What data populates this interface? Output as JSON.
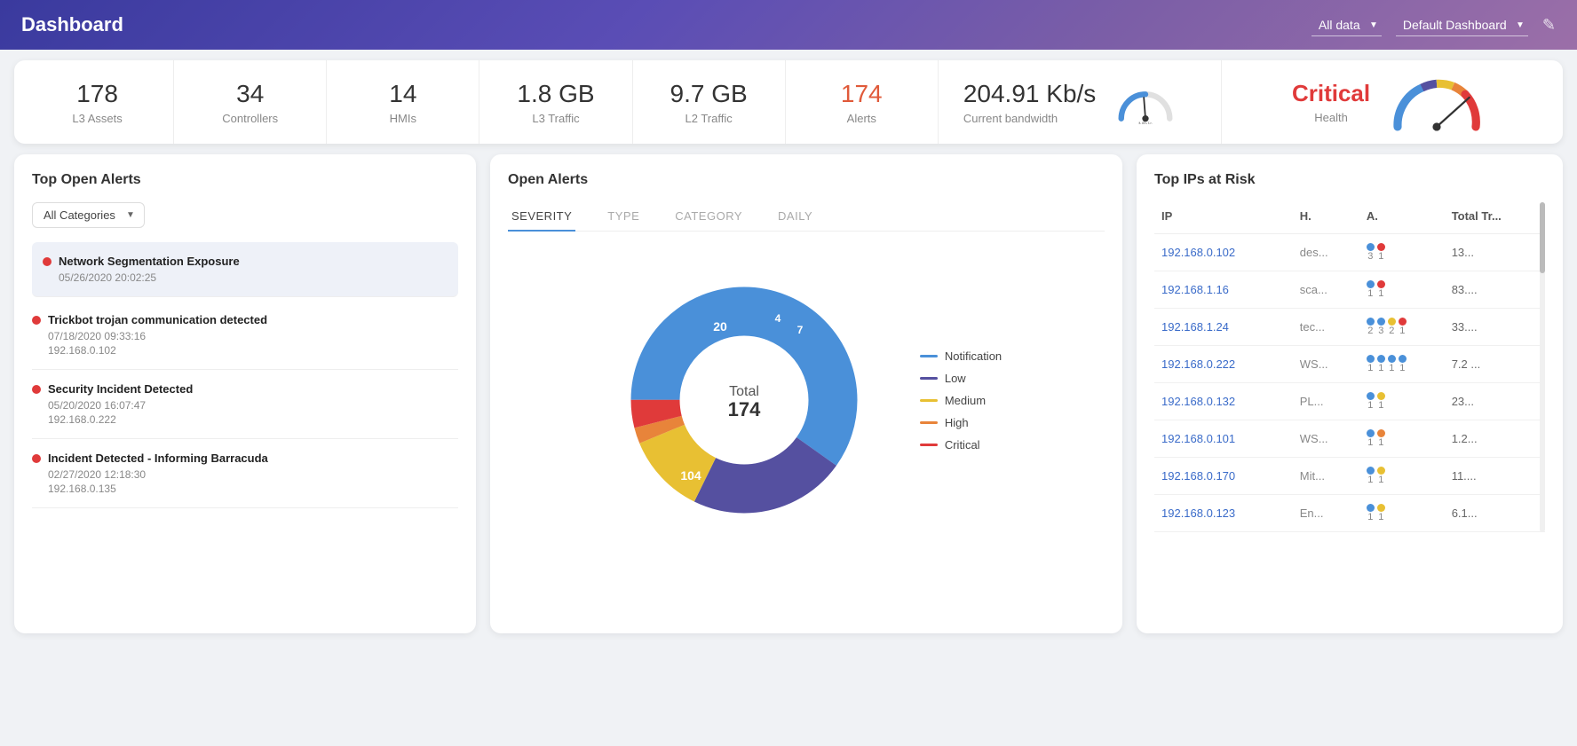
{
  "header": {
    "title": "Dashboard",
    "data_source": "All data",
    "dashboard_name": "Default Dashboard",
    "edit_icon": "✎"
  },
  "stats": [
    {
      "id": "l3-assets",
      "value": "178",
      "label": "L3 Assets",
      "color": "normal"
    },
    {
      "id": "controllers",
      "value": "34",
      "label": "Controllers",
      "color": "normal"
    },
    {
      "id": "hmis",
      "value": "14",
      "label": "HMIs",
      "color": "normal"
    },
    {
      "id": "l3-traffic",
      "value": "1.8 GB",
      "label": "L3 Traffic",
      "color": "normal"
    },
    {
      "id": "l2-traffic",
      "value": "9.7 GB",
      "label": "L2 Traffic",
      "color": "normal"
    },
    {
      "id": "alerts",
      "value": "174",
      "label": "Alerts",
      "color": "alert"
    },
    {
      "id": "bandwidth",
      "value": "204.91 Kb/s",
      "label": "Current bandwidth",
      "gauge": true
    },
    {
      "id": "health",
      "value": "Critical",
      "label": "Health",
      "color": "critical",
      "gauge": true
    }
  ],
  "top_open_alerts": {
    "title": "Top Open Alerts",
    "category_filter": "All Categories",
    "alerts": [
      {
        "title": "Network Segmentation Exposure",
        "timestamp": "05/26/2020 20:02:25",
        "ip": "",
        "selected": true
      },
      {
        "title": "Trickbot trojan communication detected",
        "timestamp": "07/18/2020 09:33:16",
        "ip": "192.168.0.102",
        "selected": false
      },
      {
        "title": "Security Incident Detected",
        "timestamp": "05/20/2020 16:07:47",
        "ip": "192.168.0.222",
        "selected": false
      },
      {
        "title": "Incident Detected - Informing Barracuda",
        "timestamp": "02/27/2020 12:18:30",
        "ip": "192.168.0.135",
        "selected": false
      }
    ]
  },
  "open_alerts_chart": {
    "title": "Open Alerts",
    "tabs": [
      "SEVERITY",
      "TYPE",
      "CATEGORY",
      "DAILY"
    ],
    "active_tab": "SEVERITY",
    "total": 174,
    "total_label": "Total 174",
    "segments": [
      {
        "label": "Notification",
        "value": 104,
        "color": "#4a90d9",
        "percent": 59.8
      },
      {
        "label": "Low",
        "value": 39,
        "color": "#5550a0",
        "percent": 22.4
      },
      {
        "label": "Medium",
        "value": 20,
        "color": "#e8c033",
        "percent": 11.5
      },
      {
        "label": "High",
        "value": 4,
        "color": "#e8843a",
        "percent": 2.3
      },
      {
        "label": "Critical",
        "value": 7,
        "color": "#e03a3a",
        "percent": 4.0
      }
    ]
  },
  "top_ips": {
    "title": "Top IPs at Risk",
    "columns": [
      "IP",
      "H.",
      "A.",
      "Total Tr..."
    ],
    "rows": [
      {
        "ip": "192.168.0.102",
        "category": "des...",
        "dots": [
          {
            "color": "#4a90d9",
            "n": "3"
          },
          {
            "color": "#e03a3a",
            "n": "1"
          }
        ],
        "total": "13..."
      },
      {
        "ip": "192.168.1.16",
        "category": "sca...",
        "dots": [
          {
            "color": "#4a90d9",
            "n": "1"
          },
          {
            "color": "#e03a3a",
            "n": "1"
          }
        ],
        "total": "83...."
      },
      {
        "ip": "192.168.1.24",
        "category": "tec...",
        "dots": [
          {
            "color": "#4a90d9",
            "n": "2"
          },
          {
            "color": "#4a90d9",
            "n": "3"
          },
          {
            "color": "#e8c033",
            "n": "2"
          },
          {
            "color": "#e03a3a",
            "n": "1"
          }
        ],
        "total": "33...."
      },
      {
        "ip": "192.168.0.222",
        "category": "WS...",
        "dots": [
          {
            "color": "#4a90d9",
            "n": "1"
          },
          {
            "color": "#4a90d9",
            "n": "1"
          },
          {
            "color": "#4a90d9",
            "n": "1"
          },
          {
            "color": "#4a90d9",
            "n": "1"
          }
        ],
        "total": "7.2 ..."
      },
      {
        "ip": "192.168.0.132",
        "category": "PL...",
        "dots": [
          {
            "color": "#4a90d9",
            "n": "1"
          },
          {
            "color": "#e8c033",
            "n": "1"
          }
        ],
        "total": "23..."
      },
      {
        "ip": "192.168.0.101",
        "category": "WS...",
        "dots": [
          {
            "color": "#4a90d9",
            "n": "1"
          },
          {
            "color": "#e8843a",
            "n": "1"
          }
        ],
        "total": "1.2..."
      },
      {
        "ip": "192.168.0.170",
        "category": "Mit...",
        "dots": [
          {
            "color": "#4a90d9",
            "n": "1"
          },
          {
            "color": "#e8c033",
            "n": "1"
          }
        ],
        "total": "11...."
      },
      {
        "ip": "192.168.0.123",
        "category": "En...",
        "dots": [
          {
            "color": "#4a90d9",
            "n": "1"
          },
          {
            "color": "#e8c033",
            "n": "1"
          }
        ],
        "total": "6.1..."
      }
    ]
  }
}
